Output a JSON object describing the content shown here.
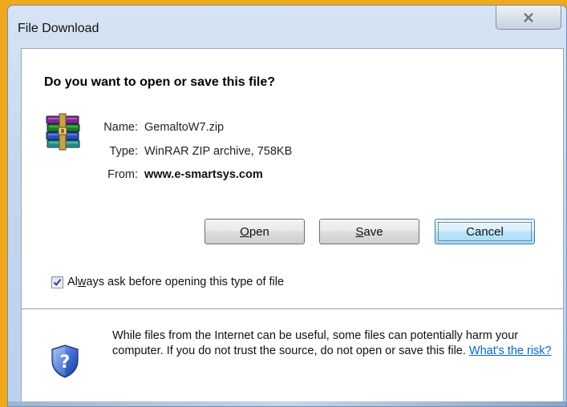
{
  "window": {
    "title": "File Download",
    "close_glyph": "✕"
  },
  "dialog": {
    "question": "Do you want to open or save this file?",
    "file": {
      "icon": "winrar-archive-icon",
      "name_label": "Name:",
      "name_value": "GemaltoW7.zip",
      "type_label": "Type:",
      "type_value": "WinRAR ZIP archive, 758KB",
      "from_label": "From:",
      "from_value": "www.e-smartsys.com"
    },
    "buttons": {
      "open_prefix": "",
      "open_access": "O",
      "open_rest": "pen",
      "save_prefix": "",
      "save_access": "S",
      "save_rest": "ave",
      "cancel": "Cancel"
    },
    "checkbox": {
      "checked": true,
      "label_prefix": "Al",
      "label_access": "w",
      "label_rest": "ays ask before opening this type of file"
    },
    "warning": {
      "icon": "security-shield-icon",
      "text": "While files from the Internet can be useful, some files can potentially harm your computer. If you do not trust the source, do not open or save this file. ",
      "link": "What's the risk?"
    }
  },
  "colors": {
    "background": "#f0a81c",
    "link": "#0066cc",
    "default_button_border": "#3c7fb1"
  }
}
